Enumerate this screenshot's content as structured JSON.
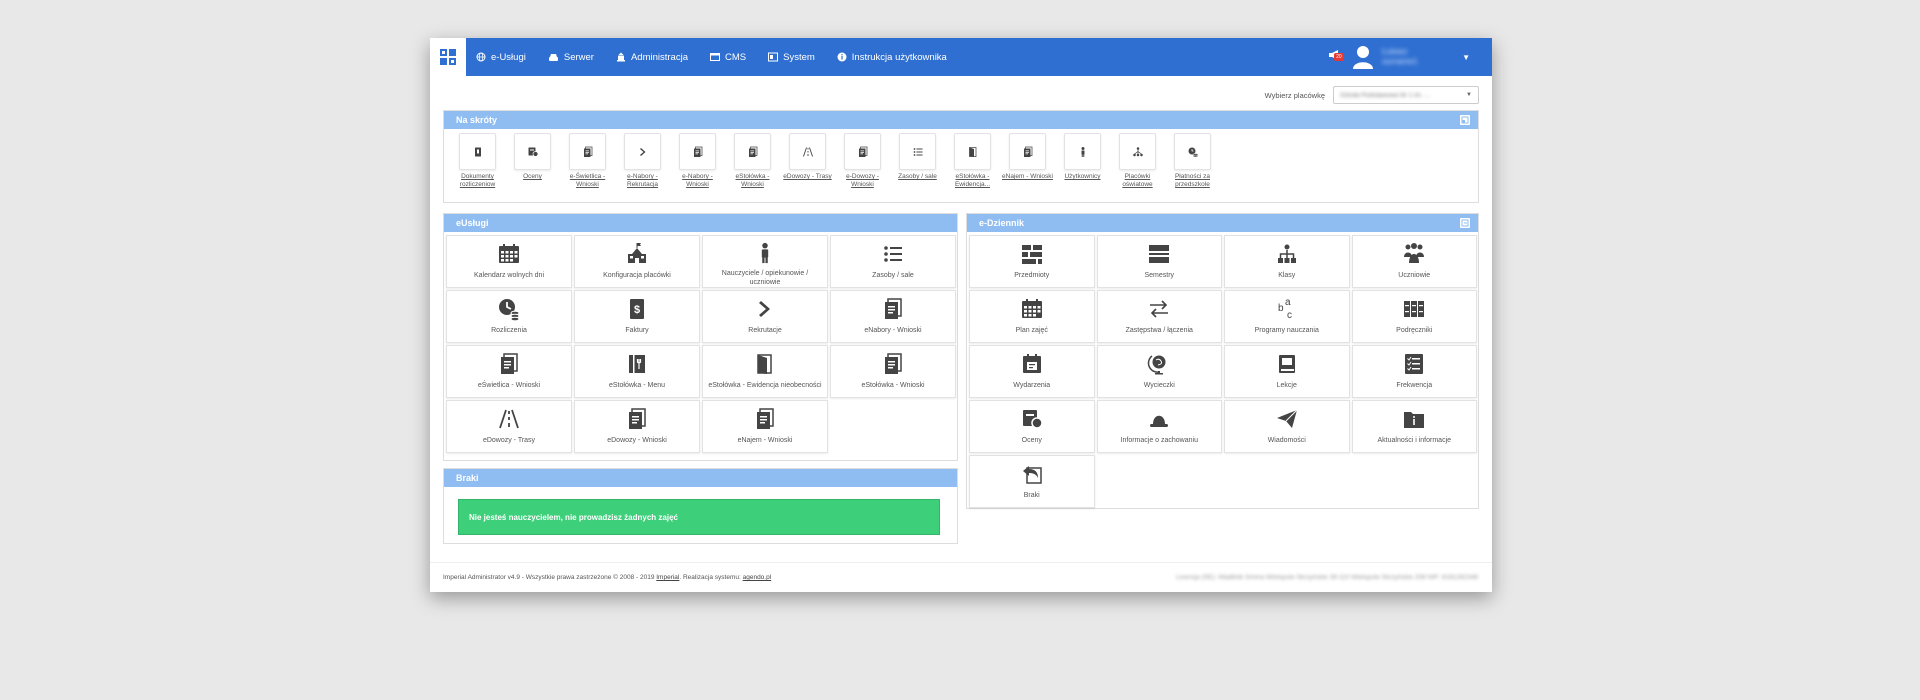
{
  "navbar": {
    "items": [
      {
        "label": "e-Usługi",
        "icon": "globe-icon"
      },
      {
        "label": "Serwer",
        "icon": "server-icon"
      },
      {
        "label": "Administracja",
        "icon": "building-icon"
      },
      {
        "label": "CMS",
        "icon": "window-icon"
      },
      {
        "label": "System",
        "icon": "windows-icon"
      },
      {
        "label": "Instrukcja użytkownika",
        "icon": "info-icon"
      }
    ],
    "notification_badge": "20",
    "user_name_line1": "Łukasz",
    "user_name_line2": "surname1"
  },
  "facility": {
    "label": "Wybierz placówkę",
    "value": "Szkoła Podstawowa Nr 1 im. ..."
  },
  "shortcuts": {
    "title": "Na skróty",
    "items": [
      {
        "label": "Dokumenty rozliczeniow",
        "icon": "document-icon"
      },
      {
        "label": "Oceny",
        "icon": "grades-icon"
      },
      {
        "label": "e-Świetlica - Wnioski",
        "icon": "forms-icon"
      },
      {
        "label": "e-Nabory - Rekrutacja",
        "icon": "chevron-right-icon"
      },
      {
        "label": "e-Nabory - Wnioski",
        "icon": "forms-icon"
      },
      {
        "label": "eStołówka - Wnioski",
        "icon": "forms-icon"
      },
      {
        "label": "eDowozy - Trasy",
        "icon": "road-icon"
      },
      {
        "label": "e-Dowozy - Wnioski",
        "icon": "forms-icon"
      },
      {
        "label": "Zasoby / sale",
        "icon": "list-icon"
      },
      {
        "label": "eStołówka - Ewidencja...",
        "icon": "door-icon"
      },
      {
        "label": "eNajem - Wnioski",
        "icon": "forms-icon"
      },
      {
        "label": "Użytkownicy",
        "icon": "user-icon"
      },
      {
        "label": "Placówki oświatowe",
        "icon": "sitemap-icon"
      },
      {
        "label": "Płatności za przedszkole",
        "icon": "coins-icon"
      }
    ]
  },
  "eservices": {
    "title": "eUsługi",
    "tiles": [
      {
        "label": "Kalendarz wolnych dni",
        "icon": "calendar-icon"
      },
      {
        "label": "Konfiguracja placówki",
        "icon": "school-icon"
      },
      {
        "label": "Nauczyciele / opiekunowie / uczniowie",
        "icon": "person-icon"
      },
      {
        "label": "Zasoby / sale",
        "icon": "list-icon"
      },
      {
        "label": "Rozliczenia",
        "icon": "clock-coins-icon"
      },
      {
        "label": "Faktury",
        "icon": "invoice-icon"
      },
      {
        "label": "Rekrutacje",
        "icon": "chevron-right-icon"
      },
      {
        "label": "eNabory - Wnioski",
        "icon": "forms-icon"
      },
      {
        "label": "eŚwietlica - Wnioski",
        "icon": "forms-icon"
      },
      {
        "label": "eStołówka - Menu",
        "icon": "menu-book-icon"
      },
      {
        "label": "eStołówka - Ewidencja nieobecności",
        "icon": "door-icon"
      },
      {
        "label": "eStołówka - Wnioski",
        "icon": "forms-icon"
      },
      {
        "label": "eDowozy - Trasy",
        "icon": "road-icon"
      },
      {
        "label": "eDowozy - Wnioski",
        "icon": "forms-icon"
      },
      {
        "label": "eNajem - Wnioski",
        "icon": "forms-icon"
      }
    ]
  },
  "ediary": {
    "title": "e-Dziennik",
    "tiles": [
      {
        "label": "Przedmioty",
        "icon": "subjects-icon"
      },
      {
        "label": "Semestry",
        "icon": "semesters-icon"
      },
      {
        "label": "Klasy",
        "icon": "classes-icon"
      },
      {
        "label": "Uczniowie",
        "icon": "students-icon"
      },
      {
        "label": "Plan zajęć",
        "icon": "calendar-icon"
      },
      {
        "label": "Zastępstwa / łączenia",
        "icon": "swap-icon"
      },
      {
        "label": "Programy nauczania",
        "icon": "abc-icon"
      },
      {
        "label": "Podręczniki",
        "icon": "books-icon"
      },
      {
        "label": "Wydarzenia",
        "icon": "event-icon"
      },
      {
        "label": "Wycieczki",
        "icon": "globe-stand-icon"
      },
      {
        "label": "Lekcje",
        "icon": "book-icon"
      },
      {
        "label": "Frekwencja",
        "icon": "checklist-icon"
      },
      {
        "label": "Oceny",
        "icon": "grades-icon"
      },
      {
        "label": "Informacje o zachowaniu",
        "icon": "bell-icon"
      },
      {
        "label": "Wiadomości",
        "icon": "paper-plane-icon"
      },
      {
        "label": "Aktualności i informacje",
        "icon": "info-folder-icon"
      },
      {
        "label": "Braki",
        "icon": "reply-icon"
      }
    ]
  },
  "gaps": {
    "title": "Braki",
    "message": "Nie jesteś nauczycielem, nie prowadzisz żadnych zajęć"
  },
  "footer": {
    "prefix": "Imperial Administrator v4.9 - Wszystkie prawa zastrzeżone © 2008 - 2019",
    "company": "Imperial",
    "mid": ". Realizacja systemu:",
    "implementer": "agendo.pl",
    "license": "Licencja (SE): Wadbhik Gmina Wielopole Skrzyńskie 39-110 Wielopole Skrzyńskie 208 NIP: 8181282348"
  },
  "colors": {
    "navbar": "#2f6fd1",
    "panel_header": "#8fbdf2",
    "alert": "#3ecf7a",
    "icon": "#444444"
  }
}
